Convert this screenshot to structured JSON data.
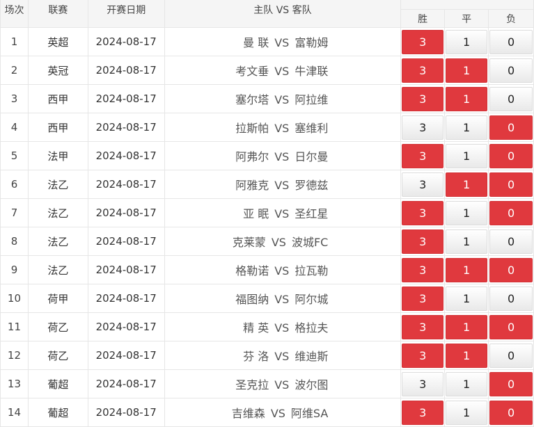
{
  "header": {
    "col_index": "场次",
    "col_league": "联赛",
    "col_date": "开赛日期",
    "col_match": "主队 VS 客队",
    "col_win": "胜",
    "col_draw": "平",
    "col_lose": "负"
  },
  "options": {
    "win": "3",
    "draw": "1",
    "lose": "0"
  },
  "vs_label": "VS",
  "colors": {
    "selected": "#e0393e",
    "unselected": "#f2f2f2"
  },
  "rows": [
    {
      "idx": "1",
      "league": "英超",
      "date": "2024-08-17",
      "home": "曼 联",
      "away": "富勒姆",
      "sel": {
        "win": true,
        "draw": false,
        "lose": false
      }
    },
    {
      "idx": "2",
      "league": "英冠",
      "date": "2024-08-17",
      "home": "考文垂",
      "away": "牛津联",
      "sel": {
        "win": true,
        "draw": true,
        "lose": false
      }
    },
    {
      "idx": "3",
      "league": "西甲",
      "date": "2024-08-17",
      "home": "塞尔塔",
      "away": "阿拉维",
      "sel": {
        "win": true,
        "draw": true,
        "lose": false
      }
    },
    {
      "idx": "4",
      "league": "西甲",
      "date": "2024-08-17",
      "home": "拉斯帕",
      "away": "塞维利",
      "sel": {
        "win": false,
        "draw": false,
        "lose": true
      }
    },
    {
      "idx": "5",
      "league": "法甲",
      "date": "2024-08-17",
      "home": "阿弗尔",
      "away": "日尔曼",
      "sel": {
        "win": true,
        "draw": false,
        "lose": true
      }
    },
    {
      "idx": "6",
      "league": "法乙",
      "date": "2024-08-17",
      "home": "阿雅克",
      "away": "罗德兹",
      "sel": {
        "win": false,
        "draw": true,
        "lose": true
      }
    },
    {
      "idx": "7",
      "league": "法乙",
      "date": "2024-08-17",
      "home": "亚 眠",
      "away": "圣红星",
      "sel": {
        "win": true,
        "draw": false,
        "lose": true
      }
    },
    {
      "idx": "8",
      "league": "法乙",
      "date": "2024-08-17",
      "home": "克莱蒙",
      "away": "波城FC",
      "sel": {
        "win": true,
        "draw": false,
        "lose": false
      }
    },
    {
      "idx": "9",
      "league": "法乙",
      "date": "2024-08-17",
      "home": "格勒诺",
      "away": "拉瓦勒",
      "sel": {
        "win": true,
        "draw": true,
        "lose": true
      }
    },
    {
      "idx": "10",
      "league": "荷甲",
      "date": "2024-08-17",
      "home": "福图纳",
      "away": "阿尔城",
      "sel": {
        "win": true,
        "draw": false,
        "lose": false
      }
    },
    {
      "idx": "11",
      "league": "荷乙",
      "date": "2024-08-17",
      "home": "精 英",
      "away": "格拉夫",
      "sel": {
        "win": true,
        "draw": true,
        "lose": true
      }
    },
    {
      "idx": "12",
      "league": "荷乙",
      "date": "2024-08-17",
      "home": "芬 洛",
      "away": "维迪斯",
      "sel": {
        "win": true,
        "draw": true,
        "lose": false
      }
    },
    {
      "idx": "13",
      "league": "葡超",
      "date": "2024-08-17",
      "home": "圣克拉",
      "away": "波尔图",
      "sel": {
        "win": false,
        "draw": false,
        "lose": true
      }
    },
    {
      "idx": "14",
      "league": "葡超",
      "date": "2024-08-17",
      "home": "吉维森",
      "away": "阿维SA",
      "sel": {
        "win": true,
        "draw": false,
        "lose": true
      }
    }
  ]
}
